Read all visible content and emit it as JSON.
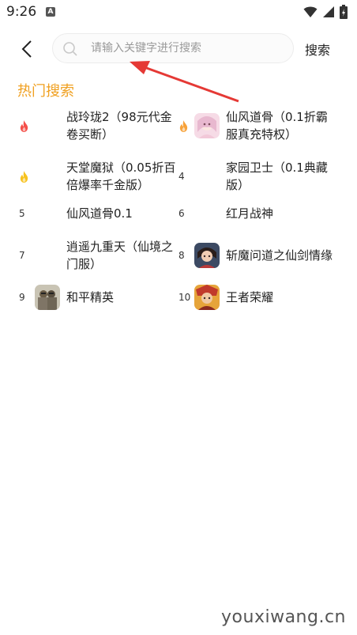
{
  "status": {
    "time": "9:26",
    "a_badge": "A"
  },
  "search": {
    "placeholder": "请输入关键字进行搜索",
    "value": "",
    "button_label": "搜索"
  },
  "hot": {
    "title": "热门搜索",
    "items": [
      {
        "rank": "",
        "rank_icon": "flame-red-icon",
        "name": "战玲珑2（98元代金卷买断）",
        "icon": ""
      },
      {
        "rank": "",
        "rank_icon": "flame-orange-icon",
        "name": "仙风道骨（0.1折霸服真充特权）",
        "icon": "game-avatar-girl-icon"
      },
      {
        "rank": "",
        "rank_icon": "flame-yellow-icon",
        "name": "天堂魔狱（0.05折百倍爆率千金版）",
        "icon": ""
      },
      {
        "rank": "4",
        "rank_icon": "",
        "name": "家园卫士（0.1典藏版）",
        "icon": ""
      },
      {
        "rank": "5",
        "rank_icon": "",
        "name": "仙风道骨0.1",
        "icon": ""
      },
      {
        "rank": "6",
        "rank_icon": "",
        "name": "红月战神",
        "icon": ""
      },
      {
        "rank": "7",
        "rank_icon": "",
        "name": "逍遥九重天（仙境之门服）",
        "icon": ""
      },
      {
        "rank": "8",
        "rank_icon": "",
        "name": "斩魔问道之仙剑情缘",
        "icon": "game-avatar-warrior-icon"
      },
      {
        "rank": "9",
        "rank_icon": "",
        "name": "和平精英",
        "icon": "game-avatar-pubg-icon"
      },
      {
        "rank": "10",
        "rank_icon": "",
        "name": "王者荣耀",
        "icon": "game-avatar-hok-icon"
      }
    ]
  },
  "watermark": "youxiwang.cn",
  "colors": {
    "accent": "#f0a020",
    "arrow": "#e53935",
    "flame_red": "#f4504a",
    "flame_orange": "#f7a23a",
    "flame_yellow": "#f7c21e"
  }
}
